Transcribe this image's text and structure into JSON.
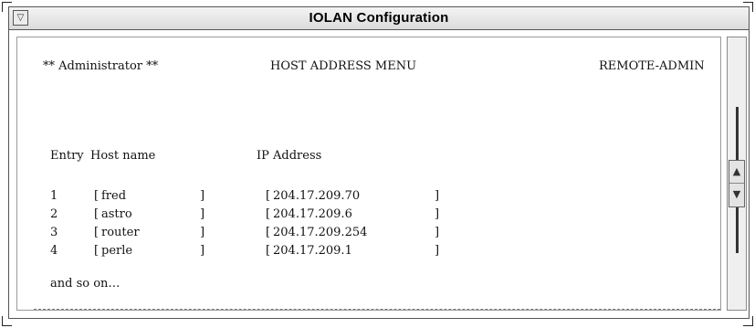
{
  "window": {
    "title": "IOLAN Configuration",
    "menu_glyph": "▽"
  },
  "header": {
    "role": "** Administrator **",
    "menu_name": "HOST ADDRESS MENU",
    "mode": "REMOTE-ADMIN"
  },
  "table": {
    "col_entry": "Entry",
    "col_host": "Host name",
    "col_ip": "IP Address",
    "rows": [
      {
        "entry": "1",
        "host": "fred",
        "ip": "204.17.209.70"
      },
      {
        "entry": "2",
        "host": "astro",
        "ip": "204.17.209.6"
      },
      {
        "entry": "3",
        "host": "router",
        "ip": "204.17.209.254"
      },
      {
        "entry": "4",
        "host": "perle",
        "ip": "204.17.209.1"
      }
    ],
    "more_text": "and so on…"
  },
  "scrollbar": {
    "up_icon": "▲",
    "down_icon": "▼"
  }
}
